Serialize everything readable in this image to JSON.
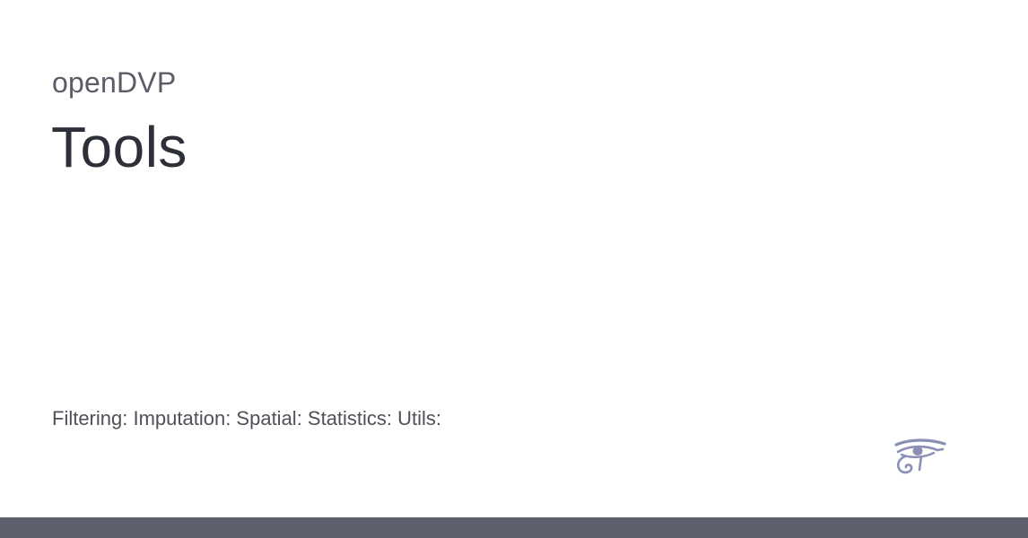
{
  "header": {
    "site_name": "openDVP",
    "page_title": "Tools"
  },
  "content": {
    "description": "Filtering: Imputation: Spatial: Statistics: Utils:"
  },
  "branding": {
    "logo_icon": "eye-of-horus-icon",
    "logo_color": "#8a90b4"
  },
  "footer": {
    "bar_color": "#5b606c"
  }
}
